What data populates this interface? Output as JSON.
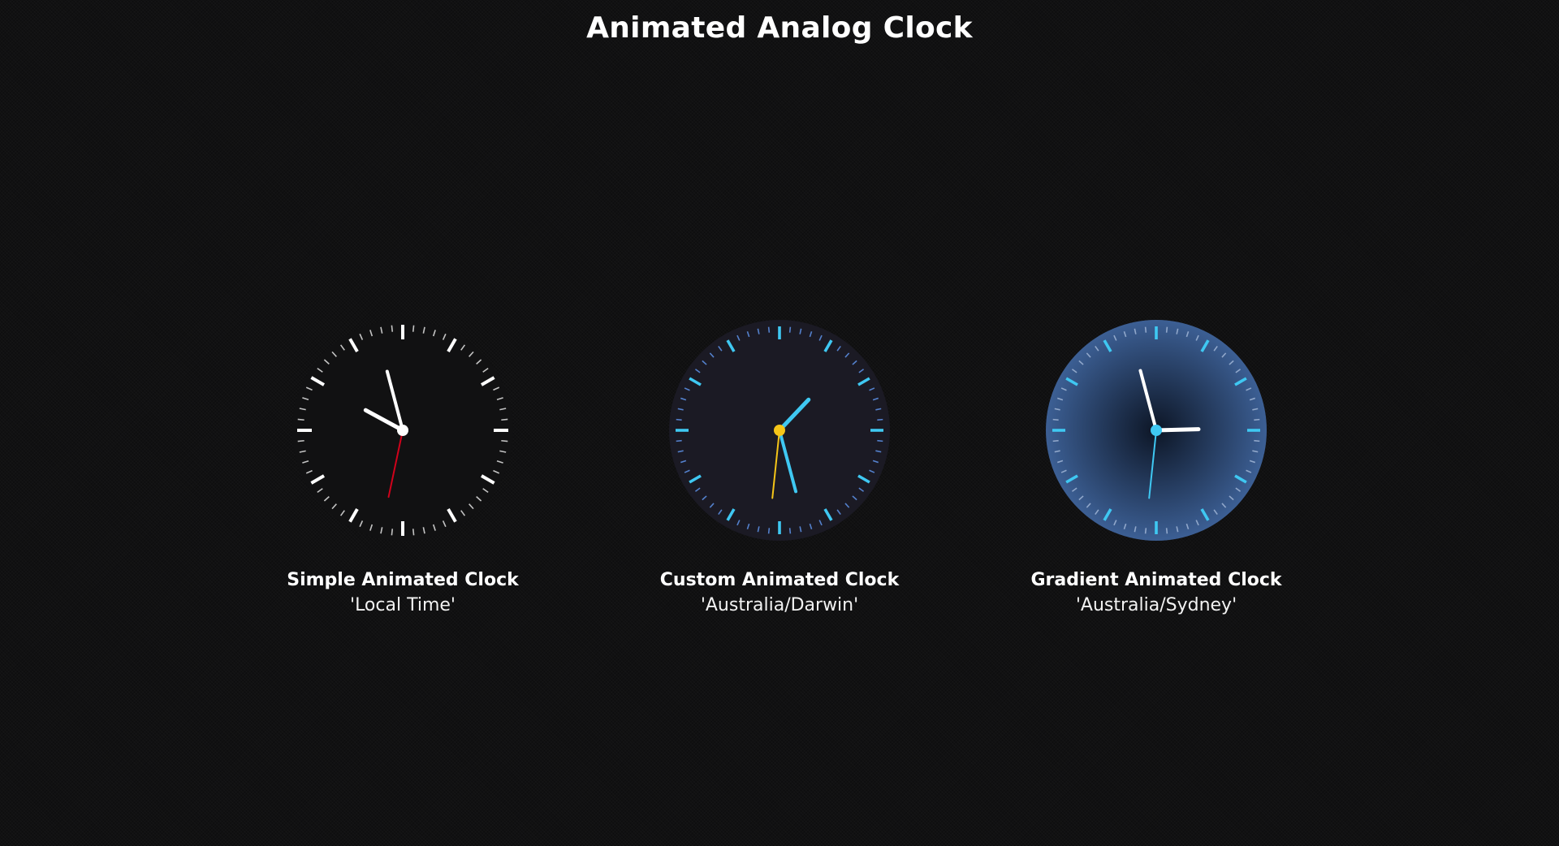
{
  "page": {
    "title": "Animated Analog Clock"
  },
  "clocks": [
    {
      "name": "Simple Animated Clock",
      "timezone": "'Local Time'",
      "style": "simple",
      "time": {
        "hour": 9,
        "minute": 57,
        "second": 32
      },
      "colors": {
        "face": "#111112",
        "ticks": "#ffffff",
        "hour_hand": "#ffffff",
        "minute_hand": "#ffffff",
        "second_hand": "#d0021b",
        "center": "#ffffff"
      }
    },
    {
      "name": "Custom Animated Clock",
      "timezone": "'Australia/Darwin'",
      "style": "custom",
      "time": {
        "hour": 1,
        "minute": 27,
        "second": 31
      },
      "colors": {
        "face": "#1b1a24",
        "ticks": "#3fc8f2",
        "hour_hand": "#3fc8f2",
        "minute_hand": "#3fc8f2",
        "second_hand": "#f5c518",
        "center": "#f5c518"
      }
    },
    {
      "name": "Gradient Animated Clock",
      "timezone": "'Australia/Sydney'",
      "style": "gradient",
      "time": {
        "hour": 2,
        "minute": 57,
        "second": 31
      },
      "colors": {
        "face_center": "#0d1626",
        "face_edge": "#3c5f94",
        "ticks": "#3fc8f2",
        "hour_hand": "#ffffff",
        "minute_hand": "#ffffff",
        "second_hand": "#3fc8f2",
        "center": "#3fc8f2"
      }
    }
  ]
}
